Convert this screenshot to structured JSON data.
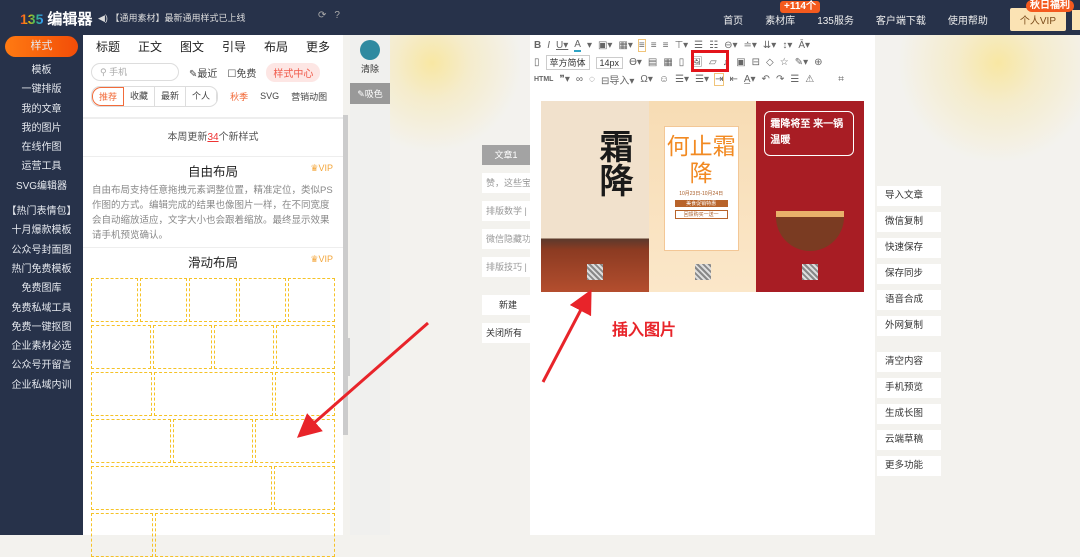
{
  "topbar": {
    "logo_mark": "135",
    "logo_text": "编辑器",
    "notice": "【通用素材】最新通用样式已上线",
    "nav": [
      {
        "label": "首页"
      },
      {
        "label": "素材库",
        "badge": "+114个"
      },
      {
        "label": "135服务"
      },
      {
        "label": "客户端下载"
      },
      {
        "label": "使用帮助"
      }
    ],
    "vip": {
      "label": "个人VIP",
      "badge": "秋日福利"
    }
  },
  "sidebar": {
    "items": [
      "样式",
      "模板",
      "一键排版",
      "我的文章",
      "我的图片",
      "在线作图",
      "运营工具",
      "SVG编辑器",
      "【热门表情包】",
      "十月爆款模板",
      "公众号封面图",
      "热门免费模板",
      "免费图库",
      "免费私域工具",
      "免费一键抠图",
      "企业素材必选",
      "公众号开留言",
      "企业私域内训"
    ]
  },
  "panel": {
    "tabs": [
      "标题",
      "正文",
      "图文",
      "引导",
      "布局",
      "更多"
    ],
    "search_placeholder": "手机",
    "recent": "最近",
    "free": "免费",
    "style_center": "样式中心",
    "filters": [
      "推荐",
      "收藏",
      "最新",
      "个人"
    ],
    "tags": [
      "秋季",
      "SVG",
      "营销动图"
    ],
    "update_prefix": "本周更新",
    "update_count": "34",
    "update_suffix": "个新样式",
    "cards": [
      {
        "title": "自由布局",
        "vip": "VIP",
        "desc": "自由布局支持任意拖拽元素调整位置，精准定位，类似PS作图的方式。编辑完成的结果也像图片一样，在不同宽度会自动缩放适应，文字大小也会跟着缩放。最终显示效果请手机预览确认。"
      },
      {
        "title": "滑动布局",
        "vip": "VIP"
      }
    ]
  },
  "color_tool": {
    "clear": "清除",
    "pick": "吸色",
    "color": "#2f8aa0"
  },
  "articles": {
    "tabs": [
      "文章1",
      "赞，这些宝",
      "排版数学 |",
      "微信隐藏功",
      "排版技巧 |"
    ],
    "new": "新建",
    "close_all": "关闭所有"
  },
  "toolbar": {
    "font": "苹方简体",
    "size": "14px",
    "html": "HTML",
    "import": "导入"
  },
  "posters": [
    {
      "title": "霜降"
    },
    {
      "title": "何止霜降",
      "date": "10月23日-10月24日",
      "promo1": "美食促销特惠",
      "promo2": "回馈购买一送一"
    },
    {
      "title": "霜降将至 来一锅温暖"
    }
  ],
  "actions": {
    "group1": [
      "导入文章",
      "微信复制",
      "快速保存",
      "保存同步",
      "语音合成",
      "外网复制"
    ],
    "group2": [
      "清空内容",
      "手机预览",
      "生成长图",
      "云端草稿",
      "更多功能"
    ]
  },
  "annotation": "插入图片"
}
